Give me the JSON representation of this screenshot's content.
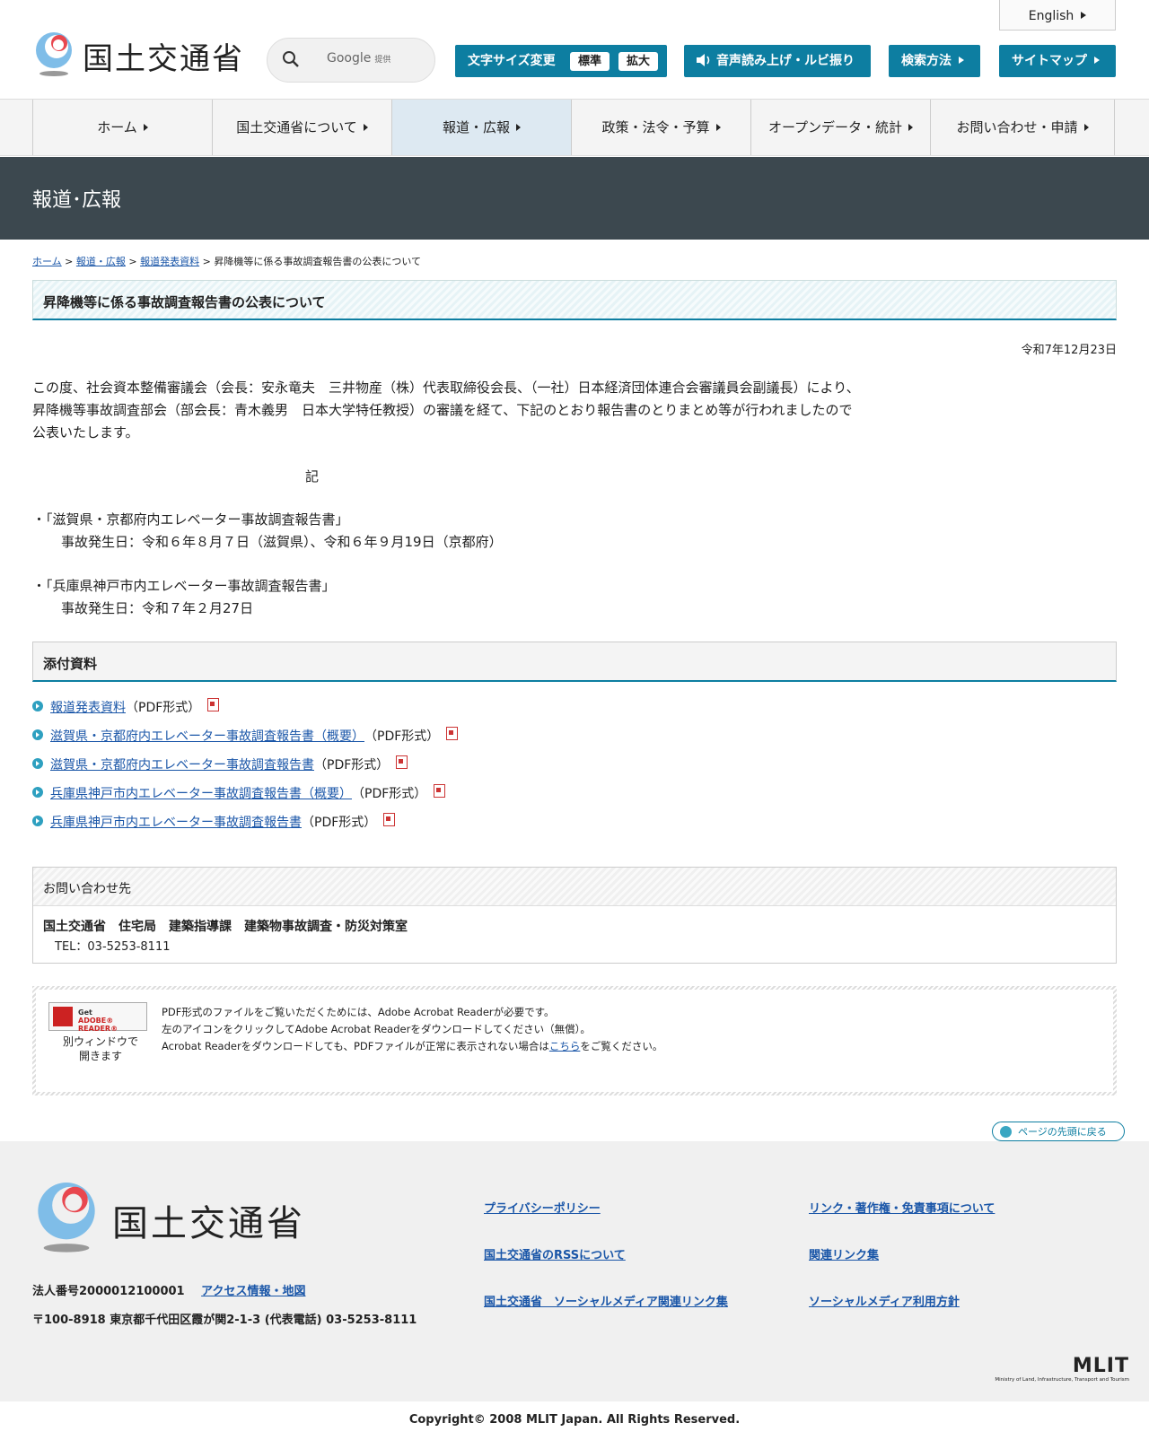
{
  "header": {
    "logo_text": "国土交通省",
    "search_placeholder": "Google",
    "search_provided": "提供",
    "english_label": "English",
    "font_size_label": "文字サイズ変更",
    "font_size_standard": "標準",
    "font_size_large": "拡大",
    "voice_label": "音声読み上げ・ルビ振り",
    "search_method_label": "検索方法",
    "sitemap_label": "サイトマップ",
    "accent_color": "#0d7ea1"
  },
  "gnav": {
    "items": [
      {
        "label": "ホーム"
      },
      {
        "label": "国土交通省について"
      },
      {
        "label": "報道・広報"
      },
      {
        "label": "政策・法令・予算"
      },
      {
        "label": "オープンデータ・統計"
      },
      {
        "label": "お問い合わせ・申請"
      }
    ],
    "active_index": 2
  },
  "banner": {
    "title": "報道･広報"
  },
  "breadcrumb": {
    "home": "ホーム",
    "sep": ">",
    "press": "報道・広報",
    "release": "報道発表資料",
    "current": "昇降機等に係る事故調査報告書の公表について"
  },
  "article": {
    "title": "昇降機等に係る事故調査報告書の公表について",
    "date": "令和7年12月23日",
    "para_line1": "この度、社会資本整備審議会（会長：安永竜夫　三井物産（株）代表取締役会長、（一社）日本経済団体連合会審議員会副議長）により、",
    "para_line2": "昇降機等事故調査部会（部会長：青木義男　日本大学特任教授）の審議を経て、下記のとおり報告書のとりまとめ等が行われましたので",
    "para_line3": "公表いたします。",
    "ki": "記",
    "item1_title": "・「滋賀県・京都府内エレベーター事故調査報告書」",
    "item1_date": "事故発生日：令和６年８月７日（滋賀県）、令和６年９月19日（京都府）",
    "item2_title": "・「兵庫県神戸市内エレベーター事故調査報告書」",
    "item2_date": "事故発生日：令和７年２月27日"
  },
  "attachments": {
    "heading": "添付資料",
    "items": [
      {
        "label": "報道発表資料",
        "format": "（PDF形式）"
      },
      {
        "label": "滋賀県・京都府内エレベーター事故調査報告書（概要）",
        "format": "（PDF形式）"
      },
      {
        "label": "滋賀県・京都府内エレベーター事故調査報告書",
        "format": "（PDF形式）"
      },
      {
        "label": "兵庫県神戸市内エレベーター事故調査報告書（概要）",
        "format": "（PDF形式）"
      },
      {
        "label": "兵庫県神戸市内エレベーター事故調査報告書",
        "format": "（PDF形式）"
      }
    ]
  },
  "contact": {
    "heading": "お問い合わせ先",
    "org": "国土交通省　住宅局　建築指導課　建築物事故調査・防災対策室",
    "tel": "TEL：03-5253-8111"
  },
  "acrobat": {
    "badge_get": "Get",
    "badge_name": "ADOBE® READER®",
    "caption1": "別ウィンドウで",
    "caption2": "開きます",
    "line1": "PDF形式のファイルをご覧いただくためには、Adobe Acrobat Readerが必要です。",
    "line2": "左のアイコンをクリックしてAdobe Acrobat Readerをダウンロードしてください（無償）。",
    "line3_pre": "Acrobat Readerをダウンロードしても、PDFファイルが正常に表示されない場合は",
    "line3_link": "こちら",
    "line3_post": "をご覧ください。"
  },
  "to_top": "ページの先頭に戻る",
  "footer": {
    "logo_text": "国土交通省",
    "corp_number": "法人番号2000012100001",
    "access": "アクセス情報・地図",
    "address": "〒100-8918 東京都千代田区霞が関2-1-3 (代表電話) 03-5253-8111",
    "links_col1": [
      "プライバシーポリシー",
      "国土交通省のRSSについて",
      "国土交通省　ソーシャルメディア関連リンク集"
    ],
    "links_col2": [
      "リンク・著作権・免責事項について",
      "関連リンク集",
      "ソーシャルメディア利用方針"
    ],
    "mlit": "MLIT",
    "mlit_sub": "Ministry of Land, Infrastructure, Transport and Tourism",
    "copyright": "Copyright© 2008 MLIT Japan. All Rights Reserved."
  }
}
